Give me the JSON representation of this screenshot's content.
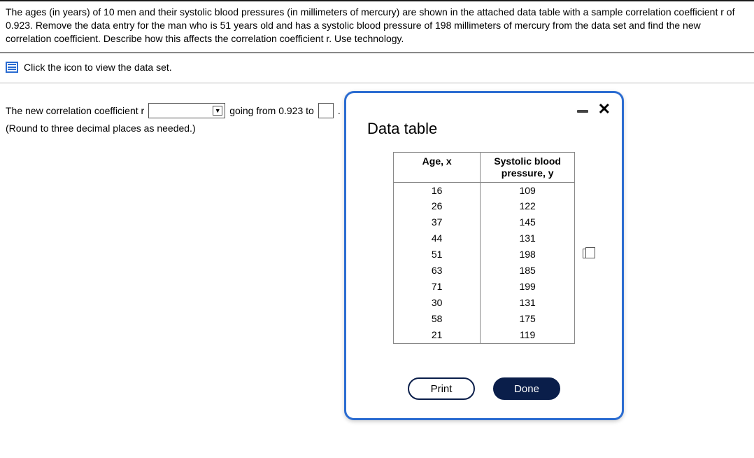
{
  "question": "The ages (in years) of 10 men and their systolic blood pressures (in millimeters of mercury) are shown in the attached data table with a sample correlation coefficient r of 0.923. Remove the data entry for the man who is 51 years old and has a systolic blood pressure of 198 millimeters of mercury from the data set and find the new correlation coefficient. Describe how this affects the correlation coefficient r. Use technology.",
  "link_text": "Click the icon to view the data set.",
  "answer": {
    "prefix": "The new correlation coefficient r",
    "mid": "going from 0.923 to",
    "suffix": ".",
    "hint": "(Round to three decimal places as needed.)"
  },
  "modal": {
    "title": "Data table",
    "col1": "Age, x",
    "col2_line1": "Systolic blood",
    "col2_line2": "pressure, y",
    "rows": [
      {
        "x": "16",
        "y": "109"
      },
      {
        "x": "26",
        "y": "122"
      },
      {
        "x": "37",
        "y": "145"
      },
      {
        "x": "44",
        "y": "131"
      },
      {
        "x": "51",
        "y": "198"
      },
      {
        "x": "63",
        "y": "185"
      },
      {
        "x": "71",
        "y": "199"
      },
      {
        "x": "30",
        "y": "131"
      },
      {
        "x": "58",
        "y": "175"
      },
      {
        "x": "21",
        "y": "119"
      }
    ],
    "print": "Print",
    "done": "Done"
  }
}
